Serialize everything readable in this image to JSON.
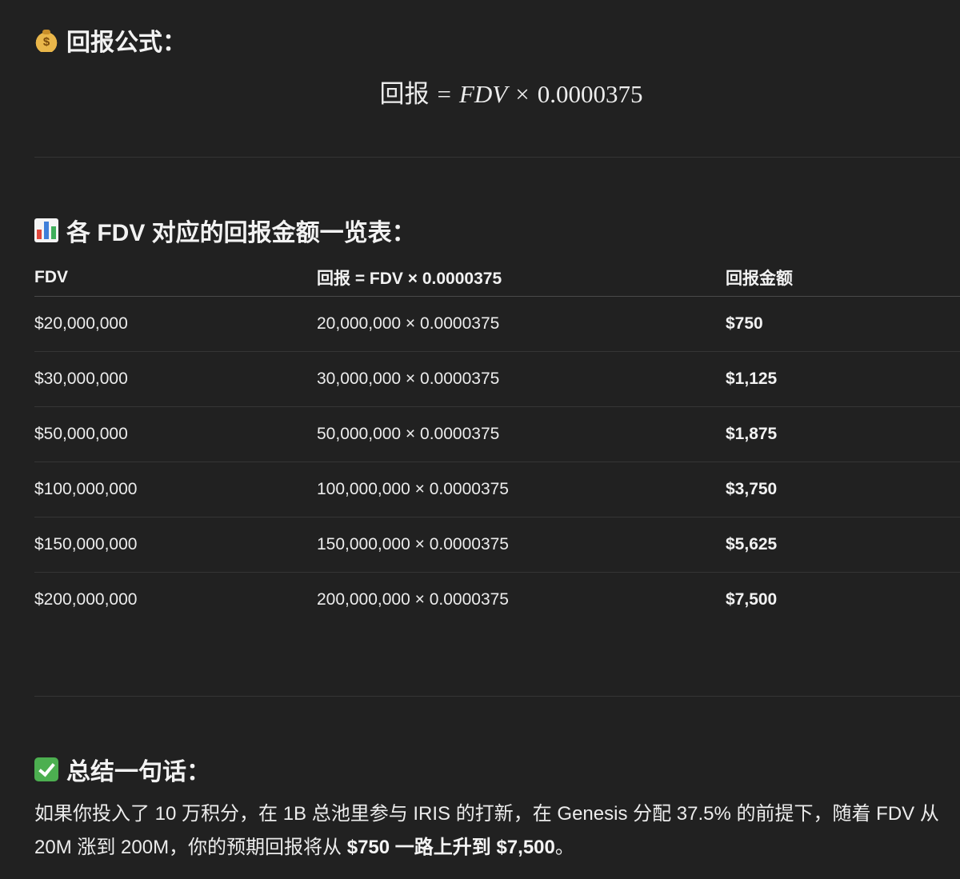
{
  "sections": {
    "formula": {
      "heading": "回报公式：",
      "icon": "money-bag-icon",
      "lhs": "回报",
      "equals": "=",
      "var": "FDV",
      "times": "×",
      "factor": "0.0000375"
    },
    "table": {
      "heading": "各 FDV 对应的回报金额一览表：",
      "icon": "bar-chart-icon",
      "columns": [
        "FDV",
        "回报 = FDV × 0.0000375",
        "回报金额"
      ],
      "rows": [
        [
          "$20,000,000",
          "20,000,000 × 0.0000375",
          "$750"
        ],
        [
          "$30,000,000",
          "30,000,000 × 0.0000375",
          "$1,125"
        ],
        [
          "$50,000,000",
          "50,000,000 × 0.0000375",
          "$1,875"
        ],
        [
          "$100,000,000",
          "100,000,000 × 0.0000375",
          "$3,750"
        ],
        [
          "$150,000,000",
          "150,000,000 × 0.0000375",
          "$5,625"
        ],
        [
          "$200,000,000",
          "200,000,000 × 0.0000375",
          "$7,500"
        ]
      ]
    },
    "summary": {
      "heading": "总结一句话：",
      "icon": "check-mark-icon",
      "line1": "如果你投入了 10 万积分，在 1B 总池里参与 IRIS 的打新，在 Genesis 分配 37.5% 的前提下，随着 FDV 从",
      "line2_pre": "20M 涨到 200M，你的预期回报将从 ",
      "line2_bold": "$750 一路上升到 $7,500",
      "line2_post": "。"
    }
  }
}
